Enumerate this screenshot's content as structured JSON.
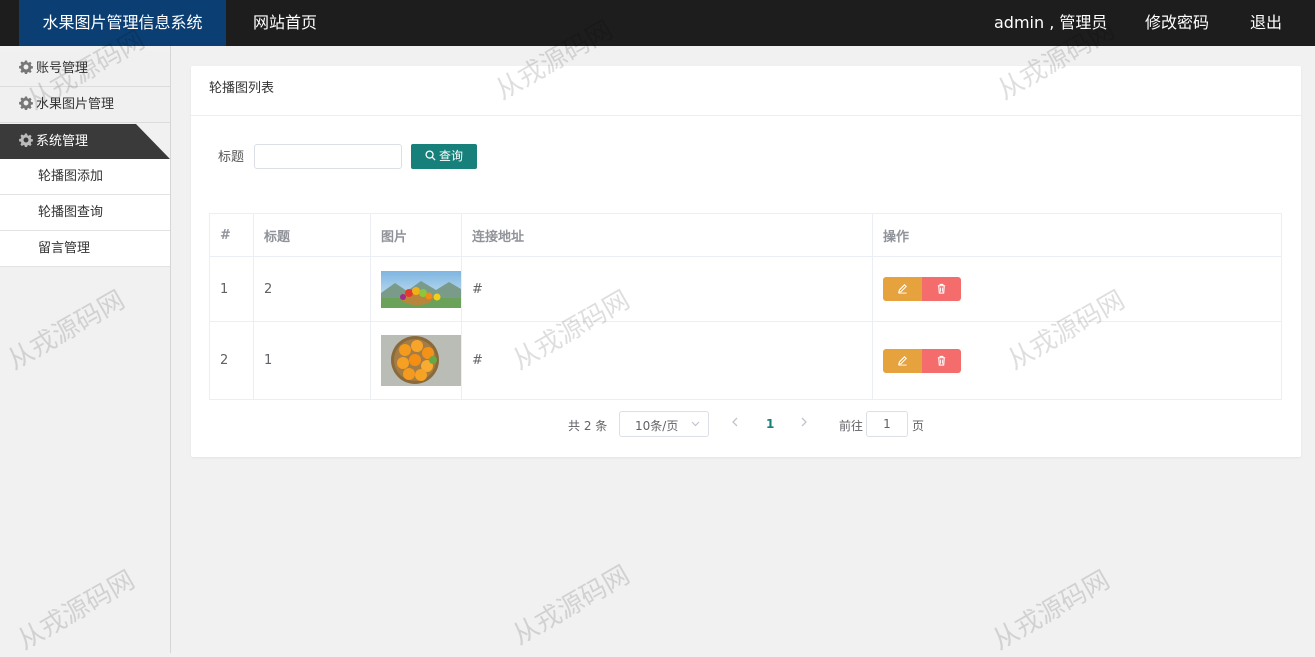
{
  "header": {
    "brand": "水果图片管理信息系统",
    "home_label": "网站首页",
    "user_label": "admin , 管理员",
    "change_password_label": "修改密码",
    "logout_label": "退出"
  },
  "sidebar": {
    "items": [
      {
        "label": "账号管理",
        "icon": "gear-icon"
      },
      {
        "label": "水果图片管理",
        "icon": "gear-icon"
      },
      {
        "label": "系统管理",
        "icon": "gear-icon",
        "active": true
      }
    ],
    "sub_items": [
      {
        "label": "轮播图添加"
      },
      {
        "label": "轮播图查询"
      },
      {
        "label": "留言管理"
      }
    ]
  },
  "main": {
    "title": "轮播图列表",
    "search": {
      "label": "标题",
      "value": "",
      "button_label": "查询",
      "button_icon": "search-icon"
    },
    "table": {
      "columns": [
        "#",
        "标题",
        "图片",
        "连接地址",
        "操作"
      ],
      "rows": [
        {
          "index": "1",
          "title": "2",
          "image": "fruit-landscape-thumbnail",
          "link": "#"
        },
        {
          "index": "2",
          "title": "1",
          "image": "oranges-basket-thumbnail",
          "link": "#"
        }
      ],
      "actions": {
        "edit_icon": "edit-icon",
        "delete_icon": "trash-icon"
      }
    },
    "pagination": {
      "total_label": "共 2 条",
      "page_size": "10条/页",
      "current_page": "1",
      "goto_label": "前往",
      "goto_value": "1",
      "page_suffix": "页"
    }
  },
  "watermark": "从戎源码网",
  "colors": {
    "topbar": "#1d1d1d",
    "brand": "#0b3f73",
    "primary": "#17807a",
    "edit": "#e6a23c",
    "delete": "#f56c6c"
  }
}
